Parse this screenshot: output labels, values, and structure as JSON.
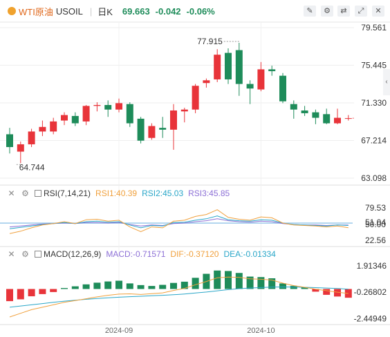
{
  "header": {
    "symbol": "WTI原油",
    "code": "USOIL",
    "period": "日K",
    "price": "69.663",
    "change": "-0.042",
    "change_pct": "-0.06%"
  },
  "toolbar": {
    "icons": [
      "draw-icon",
      "indicator-icon",
      "compare-icon",
      "fullscreen-icon",
      "close-icon"
    ]
  },
  "colors": {
    "up": "#e8343a",
    "down": "#1e8c5a",
    "rsi1": "#f0a03c",
    "rsi2": "#29a6c8",
    "rsi3": "#8c6fd6",
    "macd_line": "#f0a03c",
    "signal_line": "#29a6c8",
    "axis_text": "#333333",
    "grid": "#eeeeee"
  },
  "rsi_legend": {
    "name": "RSI(7,14,21)",
    "rsi1": "RSI1:40.39",
    "rsi2": "RSI2:45.03",
    "rsi3": "RSI3:45.85"
  },
  "macd_legend": {
    "name": "MACD(12,26,9)",
    "macd": "MACD:-0.71571",
    "dif": "DIF:-0.37120",
    "dea": "DEA:-0.01334"
  },
  "chart_data": {
    "type": "candlestick",
    "price_axis_ticks": [
      "79.561",
      "75.445",
      "71.330",
      "67.214",
      "63.098"
    ],
    "price_ylim": [
      63.098,
      79.561
    ],
    "high_label": "77.915",
    "low_label": "64.744",
    "x_ticks": [
      {
        "index": 10,
        "label": "2024-09"
      },
      {
        "index": 23,
        "label": "2024-10"
      }
    ],
    "candles": [
      {
        "o": 67.9,
        "h": 68.6,
        "l": 65.8,
        "c": 66.5
      },
      {
        "o": 66.0,
        "h": 67.1,
        "l": 64.74,
        "c": 66.8
      },
      {
        "o": 66.8,
        "h": 68.5,
        "l": 66.5,
        "c": 68.2
      },
      {
        "o": 68.2,
        "h": 69.4,
        "l": 67.7,
        "c": 68.7
      },
      {
        "o": 68.2,
        "h": 69.7,
        "l": 67.9,
        "c": 69.3
      },
      {
        "o": 69.4,
        "h": 70.3,
        "l": 68.9,
        "c": 70.0
      },
      {
        "o": 69.9,
        "h": 70.3,
        "l": 68.8,
        "c": 69.1
      },
      {
        "o": 69.3,
        "h": 71.1,
        "l": 68.9,
        "c": 71.0
      },
      {
        "o": 71.0,
        "h": 71.4,
        "l": 70.4,
        "c": 71.1
      },
      {
        "o": 71.1,
        "h": 71.6,
        "l": 69.8,
        "c": 70.6
      },
      {
        "o": 70.6,
        "h": 71.8,
        "l": 70.3,
        "c": 71.3
      },
      {
        "o": 71.2,
        "h": 71.4,
        "l": 68.7,
        "c": 69.1
      },
      {
        "o": 69.6,
        "h": 69.8,
        "l": 66.9,
        "c": 67.2
      },
      {
        "o": 67.5,
        "h": 69.1,
        "l": 67.3,
        "c": 68.8
      },
      {
        "o": 68.6,
        "h": 69.8,
        "l": 67.5,
        "c": 68.4
      },
      {
        "o": 68.4,
        "h": 71.2,
        "l": 66.2,
        "c": 70.5
      },
      {
        "o": 70.4,
        "h": 70.8,
        "l": 69.2,
        "c": 70.6
      },
      {
        "o": 70.6,
        "h": 73.4,
        "l": 70.2,
        "c": 73.2
      },
      {
        "o": 73.5,
        "h": 74.0,
        "l": 73.0,
        "c": 73.8
      },
      {
        "o": 73.9,
        "h": 77.2,
        "l": 73.6,
        "c": 76.6
      },
      {
        "o": 76.8,
        "h": 77.3,
        "l": 73.4,
        "c": 73.9
      },
      {
        "o": 77.1,
        "h": 77.9,
        "l": 72.1,
        "c": 73.4
      },
      {
        "o": 73.4,
        "h": 73.8,
        "l": 71.2,
        "c": 72.9
      },
      {
        "o": 72.8,
        "h": 75.8,
        "l": 72.6,
        "c": 75.0
      },
      {
        "o": 75.0,
        "h": 75.4,
        "l": 74.3,
        "c": 74.8
      },
      {
        "o": 74.3,
        "h": 74.6,
        "l": 71.3,
        "c": 71.5
      },
      {
        "o": 71.2,
        "h": 71.6,
        "l": 69.6,
        "c": 70.6
      },
      {
        "o": 70.5,
        "h": 71.0,
        "l": 69.9,
        "c": 70.2
      },
      {
        "o": 70.3,
        "h": 70.6,
        "l": 69.0,
        "c": 69.7
      },
      {
        "o": 70.1,
        "h": 70.7,
        "l": 69.0,
        "c": 69.1
      },
      {
        "o": 69.1,
        "h": 70.7,
        "l": 69.0,
        "c": 69.7
      },
      {
        "o": 69.6,
        "h": 70.0,
        "l": 69.4,
        "c": 69.66
      }
    ],
    "rsi": {
      "axis_ticks": [
        "79.53",
        "51.04",
        "50.00",
        "22.56"
      ],
      "ylim": [
        8,
        95
      ],
      "level_line": 50,
      "rsi1": [
        28,
        33,
        40,
        46,
        49,
        53,
        49,
        57,
        58,
        54,
        56,
        42,
        32,
        42,
        40,
        54,
        56,
        64,
        68,
        78,
        62,
        58,
        56,
        63,
        61,
        50,
        46,
        45,
        44,
        42,
        44,
        40.39
      ],
      "rsi2": [
        38,
        41,
        44,
        47,
        49,
        51,
        49,
        53,
        54,
        52,
        53,
        46,
        40,
        45,
        44,
        51,
        52,
        56,
        59,
        65,
        57,
        55,
        54,
        57,
        56,
        50,
        47,
        46,
        45,
        44,
        46,
        45.03
      ],
      "rsi3": [
        42,
        44,
        46,
        48,
        49,
        50,
        49,
        51,
        51,
        50,
        51,
        47,
        44,
        46,
        45,
        49,
        50,
        53,
        55,
        59,
        55,
        53,
        52,
        54,
        53,
        49,
        47,
        46,
        46,
        45,
        46,
        45.85
      ]
    },
    "macd": {
      "axis_ticks": [
        "1.91346",
        "-0.26802",
        "-2.44949"
      ],
      "ylim": [
        -2.7,
        2.3
      ],
      "hist": [
        -1.0,
        -0.85,
        -0.6,
        -0.42,
        -0.25,
        0.08,
        0.22,
        0.38,
        0.52,
        0.62,
        0.68,
        0.46,
        0.32,
        0.25,
        0.34,
        0.5,
        0.6,
        0.92,
        1.25,
        1.52,
        1.48,
        1.32,
        1.02,
        0.98,
        0.88,
        0.46,
        0.26,
        0.12,
        -0.22,
        -0.48,
        -0.62,
        -0.72
      ],
      "dif": [
        -2.3,
        -2.0,
        -1.7,
        -1.5,
        -1.3,
        -1.1,
        -0.95,
        -0.8,
        -0.65,
        -0.52,
        -0.42,
        -0.4,
        -0.45,
        -0.38,
        -0.32,
        -0.12,
        0.05,
        0.35,
        0.62,
        0.92,
        0.98,
        0.96,
        0.84,
        0.8,
        0.74,
        0.48,
        0.28,
        0.14,
        -0.02,
        -0.14,
        -0.26,
        -0.37
      ],
      "dea": [
        -1.5,
        -1.4,
        -1.3,
        -1.2,
        -1.1,
        -1.0,
        -0.92,
        -0.85,
        -0.78,
        -0.72,
        -0.68,
        -0.63,
        -0.6,
        -0.56,
        -0.52,
        -0.47,
        -0.41,
        -0.33,
        -0.25,
        -0.15,
        -0.05,
        0.03,
        0.08,
        0.12,
        0.15,
        0.17,
        0.16,
        0.14,
        0.11,
        0.08,
        0.04,
        -0.01
      ]
    }
  }
}
